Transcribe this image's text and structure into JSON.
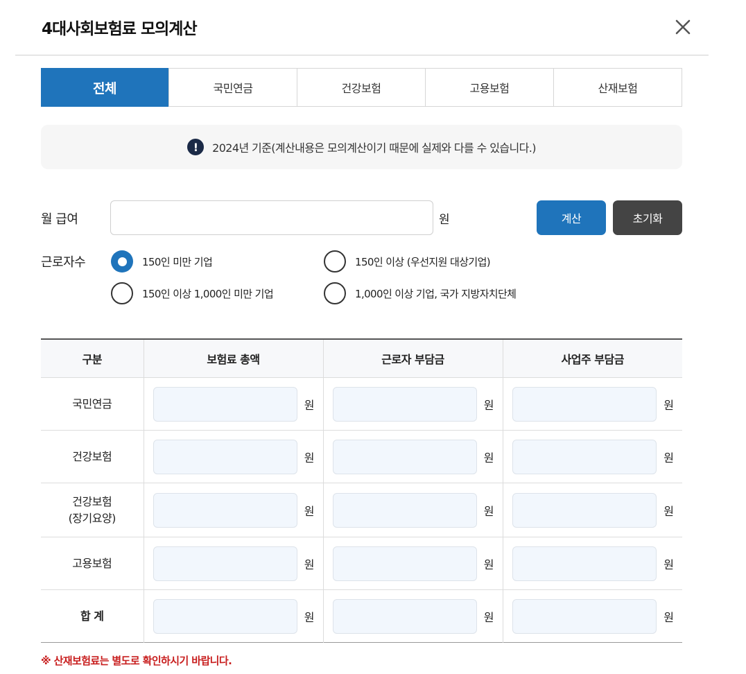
{
  "dialog": {
    "title": "4대사회보험료 모의계산",
    "close_icon": "close-icon"
  },
  "tabs": [
    {
      "label": "전체",
      "active": true
    },
    {
      "label": "국민연금",
      "active": false
    },
    {
      "label": "건강보험",
      "active": false
    },
    {
      "label": "고용보험",
      "active": false
    },
    {
      "label": "산재보험",
      "active": false
    }
  ],
  "notice": {
    "icon": "exclamation-icon",
    "text": "2024년 기준(계산내용은 모의계산이기 때문에 실제와 다를 수 있습니다.)"
  },
  "salary": {
    "label": "월 급여",
    "value": "",
    "placeholder": "",
    "unit": "원",
    "calc_label": "계산",
    "reset_label": "초기화"
  },
  "workers": {
    "label": "근로자수",
    "options": [
      {
        "label": "150인 미만 기업",
        "checked": true
      },
      {
        "label": "150인 이상 (우선지원 대상기업)",
        "checked": false
      },
      {
        "label": "150인 이상 1,000인 미만 기업",
        "checked": false
      },
      {
        "label": "1,000인 이상 기업, 국가 지방자치단체",
        "checked": false
      }
    ]
  },
  "table": {
    "headers": [
      "구분",
      "보험료 총액",
      "근로자 부담금",
      "사업주 부담금"
    ],
    "unit": "원",
    "rows": [
      {
        "label": "국민연금",
        "label2": ""
      },
      {
        "label": "건강보험",
        "label2": ""
      },
      {
        "label": "건강보험",
        "label2": "(장기요양)"
      },
      {
        "label": "고용보험",
        "label2": ""
      },
      {
        "label": "합 계",
        "label2": ""
      }
    ]
  },
  "footnote": "※ 산재보험료는 별도로 확인하시기 바랍니다.",
  "colors": {
    "accent": "#1f74bb",
    "dark_button": "#444444",
    "warning": "#c81e1e",
    "input_bg": "#f2f7fd"
  }
}
